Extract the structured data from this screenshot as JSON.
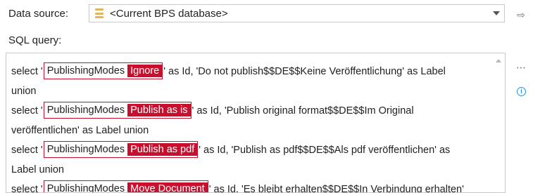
{
  "data_source": {
    "label": "Data source:",
    "selected": "<Current BPS database>",
    "icon": "database-icon"
  },
  "sql_query": {
    "label": "SQL query:",
    "lines": [
      {
        "pre": "select '",
        "token_name": "PublishingModes",
        "token_value": "Ignore",
        "post": "' as Id, 'Do not publish$$DE$$Keine Veröffentlichung' as Label"
      },
      {
        "text": "union"
      },
      {
        "pre": "select '",
        "token_name": "PublishingModes",
        "token_value": "Publish as is",
        "post": "' as Id, 'Publish original format$$DE$$Im Original"
      },
      {
        "text": "veröffentlichen' as Label union"
      },
      {
        "pre": "select '",
        "token_name": "PublishingModes",
        "token_value": "Publish as pdf",
        "post": "' as Id, 'Publish as pdf$$DE$$Als pdf veröffentlichen' as"
      },
      {
        "text": "Label union"
      },
      {
        "pre": "select '",
        "token_name": "PublishingModes",
        "token_value": "Move Document",
        "post": "' as Id, 'Es bleibt erhalten$$DE$$In Verbindung erhalten'"
      }
    ]
  },
  "buttons": {
    "go": "⇨",
    "more": "⋯",
    "info": "i"
  },
  "colors": {
    "token_accent": "#c8102e",
    "info_blue": "#2a8fd6"
  }
}
